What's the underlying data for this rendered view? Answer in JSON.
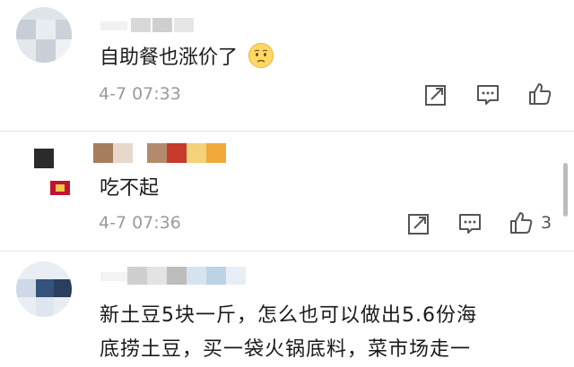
{
  "comments": [
    {
      "username": "",
      "text": "自助餐也涨价了",
      "emoji": "disappointed-face-emoji",
      "time": "4-7 07:33",
      "like_count": ""
    },
    {
      "username": "",
      "text": "吃不起",
      "time": "4-7 07:36",
      "like_count": "3"
    },
    {
      "username": "",
      "lines": [
        "新土豆5块一斤，怎么也可以做出5.6份海",
        "底捞土豆，买一袋火锅底料，菜市场走一"
      ]
    }
  ],
  "icons": {
    "share": "share-icon",
    "comment": "comment-icon",
    "like": "thumbs-up-icon"
  },
  "colors": {
    "text": "#1a1a1a",
    "meta": "#9a9a9a",
    "icon": "#555555",
    "divider": "#e6e6e6"
  }
}
